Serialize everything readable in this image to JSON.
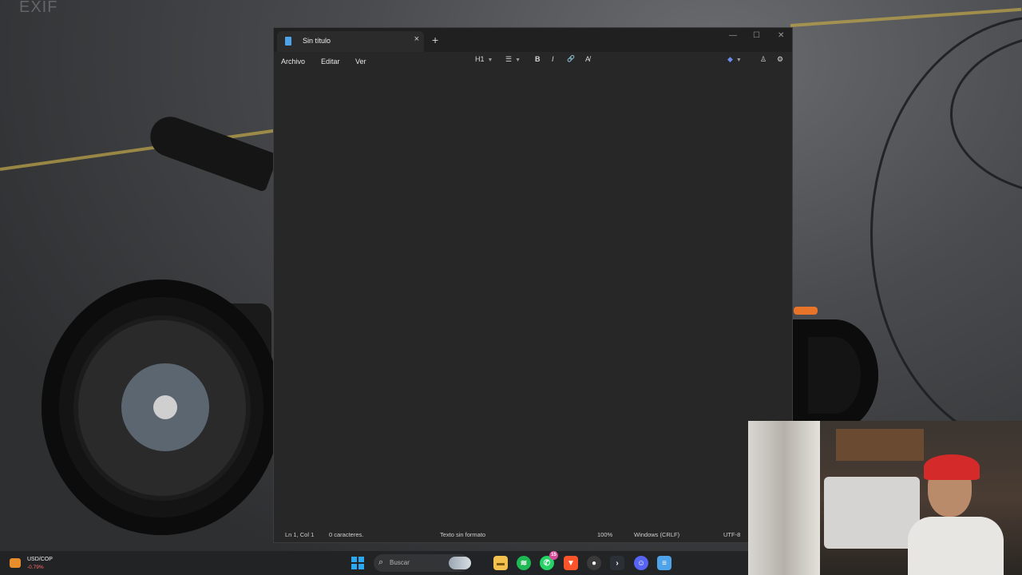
{
  "wallpaper": {
    "watermark": "EXIF"
  },
  "notepad": {
    "tab_title": "Sin título",
    "tab_close_glyph": "×",
    "new_tab_glyph": "+",
    "controls": {
      "minimize": "—",
      "maximize": "☐",
      "close": "✕"
    },
    "menu": [
      "Archivo",
      "Editar",
      "Ver"
    ],
    "toolbar": {
      "heading": "H1",
      "list": "☰",
      "bold": "B",
      "italic": "I",
      "link": "🔗",
      "clear_format": "A̸",
      "copilot": "◆",
      "account": "♙",
      "settings": "⚙"
    },
    "content": "",
    "status": {
      "position": "Ln 1, Col 1",
      "chars": "0 caracteres.",
      "format": "Texto sin formato",
      "zoom": "100%",
      "line_ending": "Windows (CRLF)",
      "encoding": "UTF-8"
    }
  },
  "taskbar": {
    "ticker": {
      "pair": "USD/COP",
      "delta": "-0.79%"
    },
    "search_placeholder": "Buscar",
    "search_icon": "⌕",
    "apps": [
      {
        "name": "file-explorer",
        "glyph": "▬",
        "color": "#f2c14e"
      },
      {
        "name": "spotify",
        "glyph": "≋",
        "color": "#1db954"
      },
      {
        "name": "whatsapp",
        "glyph": "✆",
        "color": "#25d366",
        "badge": "15"
      },
      {
        "name": "brave",
        "glyph": "▼",
        "color": "#fb542b"
      },
      {
        "name": "obs",
        "glyph": "●",
        "color": "#3a3a3a"
      },
      {
        "name": "terminal",
        "glyph": "›",
        "color": "#2b2f36"
      },
      {
        "name": "discord",
        "glyph": "☺",
        "color": "#5865f2"
      },
      {
        "name": "notepad",
        "glyph": "≡",
        "color": "#4fa3e8"
      }
    ]
  }
}
